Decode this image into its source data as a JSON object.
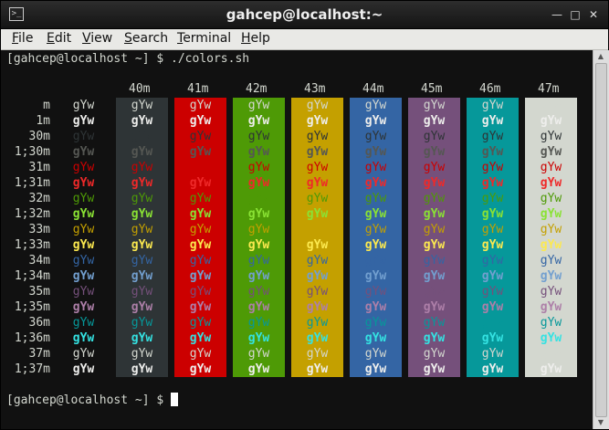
{
  "window": {
    "title": "gahcep@localhost:~",
    "icon": "terminal-icon"
  },
  "menu": [
    {
      "label": "File",
      "accel": "F",
      "rest": "ile"
    },
    {
      "label": "Edit",
      "accel": "E",
      "rest": "dit"
    },
    {
      "label": "View",
      "accel": "V",
      "rest": "iew"
    },
    {
      "label": "Search",
      "accel": "S",
      "rest": "earch"
    },
    {
      "label": "Terminal",
      "accel": "T",
      "rest": "erminal"
    },
    {
      "label": "Help",
      "accel": "H",
      "rest": "elp"
    }
  ],
  "terminal": {
    "command_line": "[gahcep@localhost ~] $ ./colors.sh",
    "prompt_line": "[gahcep@localhost ~] $ ",
    "sample_text": "gYw",
    "no_bg_sample": "gYw",
    "bg_headers": [
      "40m",
      "41m",
      "42m",
      "43m",
      "44m",
      "45m",
      "46m",
      "47m"
    ],
    "row_labels": [
      "m",
      "1m",
      "30m",
      "1;30m",
      "31m",
      "1;31m",
      "32m",
      "1;32m",
      "33m",
      "1;33m",
      "34m",
      "1;34m",
      "35m",
      "1;35m",
      "36m",
      "1;36m",
      "37m",
      "1;37m"
    ],
    "bg_colors": [
      "#2e3436",
      "#cc0000",
      "#4e9a06",
      "#c4a000",
      "#3465a4",
      "#75507b",
      "#06989a",
      "#d3d7cf"
    ],
    "fg_colors": [
      "#d3d7cf",
      "#eeeeec",
      "#2e3436",
      "#555753",
      "#cc0000",
      "#ef2929",
      "#4e9a06",
      "#8ae234",
      "#c4a000",
      "#fce94f",
      "#3465a4",
      "#729fcf",
      "#75507b",
      "#ad7fa8",
      "#06989a",
      "#34e2e2",
      "#d3d7cf",
      "#eeeeec"
    ],
    "default_fg": "#d3d7cf",
    "default_bg": "#111111"
  }
}
